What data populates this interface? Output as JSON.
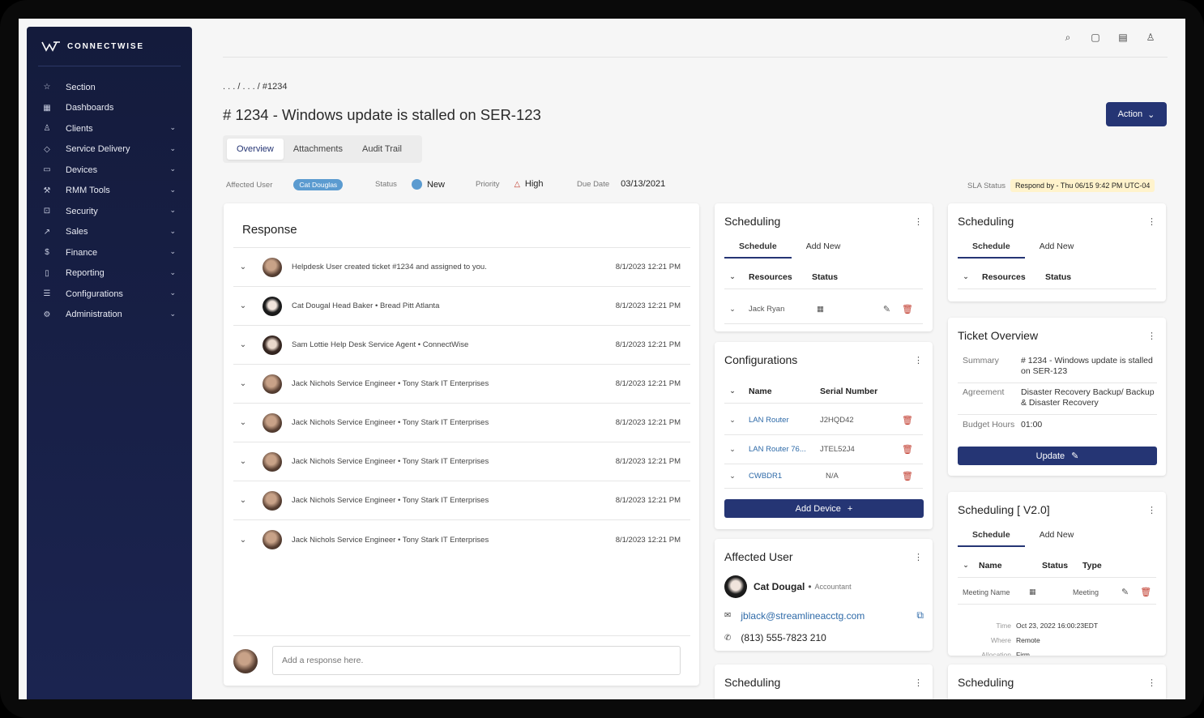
{
  "brand": {
    "name": "CONNECTWISE"
  },
  "sidebar": {
    "items": [
      {
        "label": "Section",
        "icon": "star-icon",
        "expandable": false
      },
      {
        "label": "Dashboards",
        "icon": "grid-icon",
        "expandable": false
      },
      {
        "label": "Clients",
        "icon": "user-icon",
        "expandable": true
      },
      {
        "label": "Service Delivery",
        "icon": "tag-icon",
        "expandable": true
      },
      {
        "label": "Devices",
        "icon": "monitor-icon",
        "expandable": true
      },
      {
        "label": "RMM Tools",
        "icon": "wrench-icon",
        "expandable": true
      },
      {
        "label": "Security",
        "icon": "lock-icon",
        "expandable": true
      },
      {
        "label": "Sales",
        "icon": "trend-icon",
        "expandable": true
      },
      {
        "label": "Finance",
        "icon": "dollar-icon",
        "expandable": true
      },
      {
        "label": "Reporting",
        "icon": "document-icon",
        "expandable": true
      },
      {
        "label": "Configurations",
        "icon": "sliders-icon",
        "expandable": true
      },
      {
        "label": "Administration",
        "icon": "gear-icon",
        "expandable": true
      }
    ]
  },
  "breadcrumb": ". . .  /  . . .  /  #1234",
  "page": {
    "title": "# 1234 - Windows update is stalled on SER-123",
    "action_label": "Action"
  },
  "tabs": [
    "Overview",
    "Attachments",
    "Audit Trail"
  ],
  "meta": {
    "affected_user_label": "Affected User",
    "affected_user": "Cat Douglas",
    "status_label": "Status",
    "status": "New",
    "priority_label": "Priority",
    "priority": "High",
    "due_label": "Due Date",
    "due": "03/13/2021",
    "sla_label": "SLA Status",
    "sla": "Respond by - Thu 06/15 9:42 PM UTC-04"
  },
  "response": {
    "title": "Response",
    "rows": [
      {
        "who": "Helpdesk User created ticket #1234 and assigned to you.",
        "when": "8/1/2023 12:21 PM"
      },
      {
        "who": "Cat Dougal  Head Baker • Bread Pitt Atlanta",
        "when": "8/1/2023 12:21 PM"
      },
      {
        "who": "Sam Lottie  Help Desk Service Agent • ConnectWise",
        "when": "8/1/2023 12:21 PM"
      },
      {
        "who": "Jack Nichols  Service Engineer • Tony Stark IT Enterprises",
        "when": "8/1/2023 12:21 PM"
      },
      {
        "who": "Jack Nichols  Service Engineer • Tony Stark IT Enterprises",
        "when": "8/1/2023 12:21 PM"
      },
      {
        "who": "Jack Nichols  Service Engineer • Tony Stark IT Enterprises",
        "when": "8/1/2023 12:21 PM"
      },
      {
        "who": "Jack Nichols  Service Engineer • Tony Stark IT Enterprises",
        "when": "8/1/2023 12:21 PM"
      },
      {
        "who": "Jack Nichols  Service Engineer • Tony Stark IT Enterprises",
        "when": "8/1/2023 12:21 PM"
      }
    ],
    "placeholder": "Add a response here."
  },
  "scheduling1": {
    "title": "Scheduling",
    "tab1": "Schedule",
    "tab2": "Add New",
    "col1": "Resources",
    "col2": "Status",
    "row_resource": "Jack Ryan"
  },
  "scheduling2": {
    "title": "Scheduling",
    "tab1": "Schedule",
    "tab2": "Add New",
    "col1": "Resources",
    "col2": "Status"
  },
  "configurations": {
    "title": "Configurations",
    "col1": "Name",
    "col2": "Serial Number",
    "rows": [
      {
        "name": "LAN Router",
        "serial": "J2HQD42"
      },
      {
        "name": "LAN Router 76...",
        "serial": "JTEL52J4"
      },
      {
        "name": "CWBDR1",
        "serial": "N/A"
      }
    ],
    "button": "Add Device"
  },
  "affected_user": {
    "title": "Affected User",
    "name": "Cat Dougal",
    "role": "Accountant",
    "email": "jblack@streamlineacctg.com",
    "phone": "(813) 555-7823  210"
  },
  "ticket_overview": {
    "title": "Ticket Overview",
    "summary_label": "Summary",
    "summary": "# 1234 - Windows update is stalled on SER-123",
    "agreement_label": "Agreement",
    "agreement": "Disaster Recovery Backup/ Backup & Disaster Recovery",
    "budget_label": "Budget Hours",
    "budget": "01:00",
    "button": "Update"
  },
  "scheduling_v2": {
    "title": "Scheduling [ V2.0]",
    "tab1": "Schedule",
    "tab2": "Add New",
    "col1": "Name",
    "col2": "Status",
    "col3": "Type",
    "row_name": "Meeting Name",
    "row_type": "Meeting",
    "time_label": "Time",
    "time": "Oct 23, 2022 16:00:23EDT",
    "where_label": "Where",
    "where": "Remote",
    "alloc_label": "Allocation",
    "alloc": "Firm"
  },
  "scheduling3": {
    "title": "Scheduling"
  },
  "scheduling4": {
    "title": "Scheduling"
  },
  "colors": {
    "accent": "#253574",
    "sidebar": "#141b3c",
    "status": "#5b9bd0",
    "sla_bg": "#fff3cc",
    "danger": "#c0392b"
  }
}
